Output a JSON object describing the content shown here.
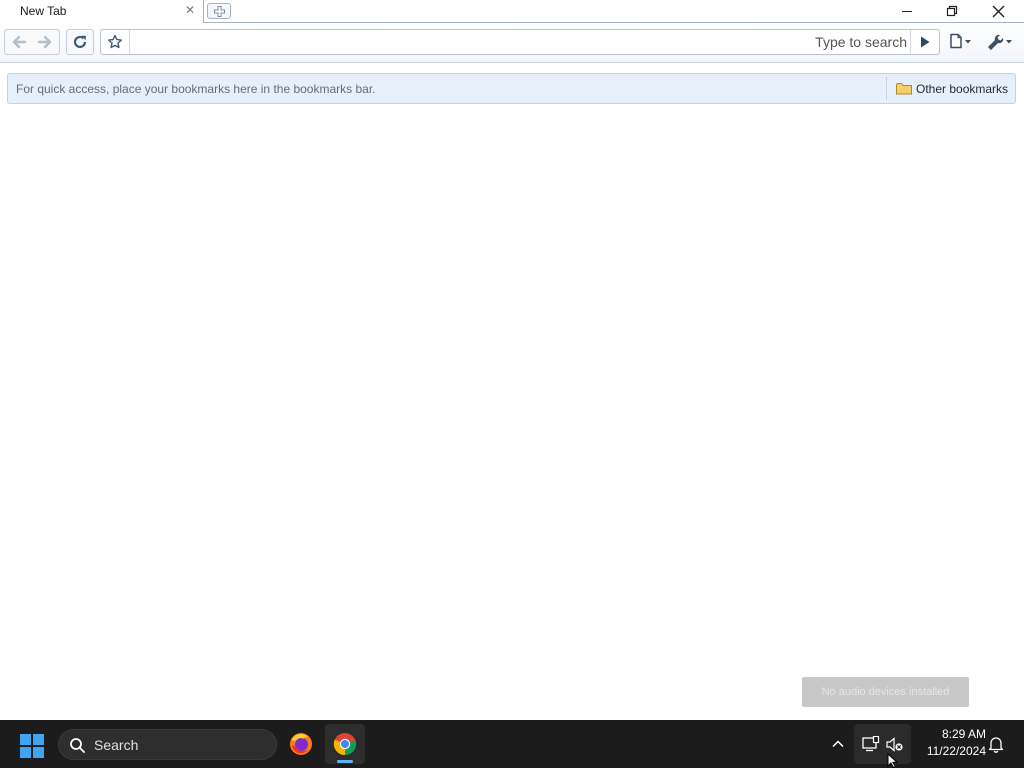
{
  "browser": {
    "tab": {
      "title": "New Tab",
      "close_glyph": "✕"
    },
    "new_tab_icon": "new-tab-icon",
    "window_controls": [
      "minimize-icon",
      "restore-icon",
      "close-icon"
    ],
    "toolbar": {
      "back_icon": "back-arrow-icon",
      "forward_icon": "forward-arrow-icon",
      "reload_icon": "reload-icon",
      "star_icon": "star-icon",
      "omnibox_value": "",
      "omnibox_hint": "Type to search",
      "go_icon": "go-arrow-icon",
      "page_menu_icon": "page-menu-icon",
      "wrench_menu_icon": "wrench-menu-icon"
    },
    "bookmarks_bar": {
      "hint": "For quick access, place your bookmarks here in the bookmarks bar.",
      "other_bookmarks": "Other bookmarks",
      "folder_icon": "folder-icon"
    }
  },
  "toast": {
    "text": "No audio devices installed"
  },
  "taskbar": {
    "search_label": "Search",
    "apps": [
      "firefox-icon",
      "chrome-icon"
    ],
    "active_app": "chrome-icon",
    "clock": {
      "time": "8:29 AM",
      "date": "11/22/2024"
    }
  },
  "colors": {
    "accent": "#5fb2f2",
    "taskbar_bg": "#1c1c1c",
    "bookmarks_bg": "#e6f0fa"
  }
}
